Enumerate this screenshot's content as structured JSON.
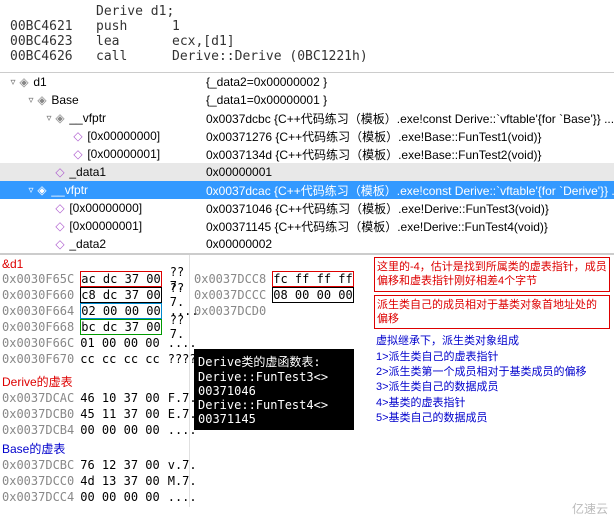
{
  "disasm": {
    "header": "Derive d1;",
    "lines": [
      {
        "addr": "00BC4621",
        "mnem": "push",
        "op": "1"
      },
      {
        "addr": "00BC4623",
        "mnem": "lea",
        "op": "ecx,[d1]"
      },
      {
        "addr": "00BC4626",
        "mnem": "call",
        "op": "Derive::Derive (0BC1221h)"
      }
    ]
  },
  "tree": [
    {
      "indent": 0,
      "tri": "▿",
      "icon": "◈",
      "name": "d1",
      "value": "{_data2=0x00000002 }"
    },
    {
      "indent": 1,
      "tri": "▿",
      "icon": "◈",
      "name": "Base",
      "value": "{_data1=0x00000001 }"
    },
    {
      "indent": 2,
      "tri": "▿",
      "icon": "◈",
      "name": "__vfptr",
      "value": "0x0037dcbc {C++代码练习（模板）.exe!const Derive::`vftable'{for `Base'}} ..."
    },
    {
      "indent": 3,
      "tri": "",
      "icon": "◇",
      "purple": true,
      "name": "[0x00000000]",
      "value": "0x00371276 {C++代码练习（模板）.exe!Base::FunTest1(void)}"
    },
    {
      "indent": 3,
      "tri": "",
      "icon": "◇",
      "purple": true,
      "name": "[0x00000001]",
      "value": "0x0037134d {C++代码练习（模板）.exe!Base::FunTest2(void)}"
    },
    {
      "indent": 2,
      "tri": "",
      "icon": "◇",
      "purple": true,
      "name": "_data1",
      "value": "0x00000001",
      "datasel": true
    },
    {
      "indent": 1,
      "tri": "▿",
      "icon": "◈",
      "name": "__vfptr",
      "value": "0x0037dcac {C++代码练习（模板）.exe!const Derive::`vftable'{for `Derive'}} ...",
      "selected": true
    },
    {
      "indent": 2,
      "tri": "",
      "icon": "◇",
      "purple": true,
      "name": "[0x00000000]",
      "value": "0x00371046 {C++代码练习（模板）.exe!Derive::FunTest3(void)}"
    },
    {
      "indent": 2,
      "tri": "",
      "icon": "◇",
      "purple": true,
      "name": "[0x00000001]",
      "value": "0x00371145 {C++代码练习（模板）.exe!Derive::FunTest4(void)}"
    },
    {
      "indent": 2,
      "tri": "",
      "icon": "◇",
      "purple": true,
      "name": "_data2",
      "value": "0x00000002"
    }
  ],
  "mem_left": {
    "title": "&d1",
    "rows": [
      {
        "addr": "0x0030F65C",
        "bytes": "ac dc 37 00",
        "box": "redbox",
        "ascii": "??7."
      },
      {
        "addr": "0x0030F660",
        "bytes": "c8 dc 37 00",
        "box": "blackbox",
        "ascii": "??7."
      },
      {
        "addr": "0x0030F664",
        "bytes": "02 00 00 00",
        "box": "bluebox",
        "ascii": "...."
      },
      {
        "addr": "0x0030F668",
        "bytes": "bc dc 37 00",
        "box": "greenbox",
        "ascii": "??7."
      },
      {
        "addr": "0x0030F66C",
        "bytes": "01 00 00 00",
        "box": "",
        "ascii": "...."
      },
      {
        "addr": "0x0030F670",
        "bytes": "cc cc cc cc",
        "box": "",
        "ascii": "????"
      }
    ],
    "section1_title": "Derive的虚表",
    "section1": [
      {
        "addr": "0x0037DCAC",
        "bytes": "46 10 37 00",
        "ascii": "F.7."
      },
      {
        "addr": "0x0037DCB0",
        "bytes": "45 11 37 00",
        "ascii": "E.7."
      },
      {
        "addr": "0x0037DCB4",
        "bytes": "00 00 00 00",
        "ascii": "...."
      }
    ],
    "section2_title": "Base的虚表",
    "section2": [
      {
        "addr": "0x0037DCBC",
        "bytes": "76 12 37 00",
        "ascii": "v.7."
      },
      {
        "addr": "0x0037DCC0",
        "bytes": "4d 13 37 00",
        "ascii": "M.7."
      },
      {
        "addr": "0x0037DCC4",
        "bytes": "00 00 00 00",
        "ascii": "...."
      }
    ]
  },
  "mem_mid": {
    "rows": [
      {
        "addr": "0x0037DCC8",
        "bytes": "fc ff ff ff",
        "box": "redbox"
      },
      {
        "addr": "0x0037DCCC",
        "bytes": "08 00 00 00",
        "box": "blackbox"
      },
      {
        "addr": "0x0037DCD0",
        "bytes": ""
      }
    ]
  },
  "console": {
    "title": "Derive类的虚函数表:",
    "lines": [
      "Derive::FunTest3<>",
      "00371046",
      "Derive::FunTest4<>",
      "00371145"
    ]
  },
  "annot": {
    "box1": "这里的-4，估计是找到所属类的虚表指针，成员偏移和虚表指针刚好相差4个字节",
    "box2": "派生类自己的成员相对于基类对象首地址处的偏移",
    "blue_title": "虚拟继承下，派生类对象组成",
    "blue_lines": [
      "1>派生类自己的虚表指针",
      "2>派生类第一个成员相对于基类成员的偏移",
      "3>派生类自己的数据成员",
      "4>基类的虚表指针",
      "5>基类自己的数据成员"
    ]
  },
  "watermark": "亿速云"
}
